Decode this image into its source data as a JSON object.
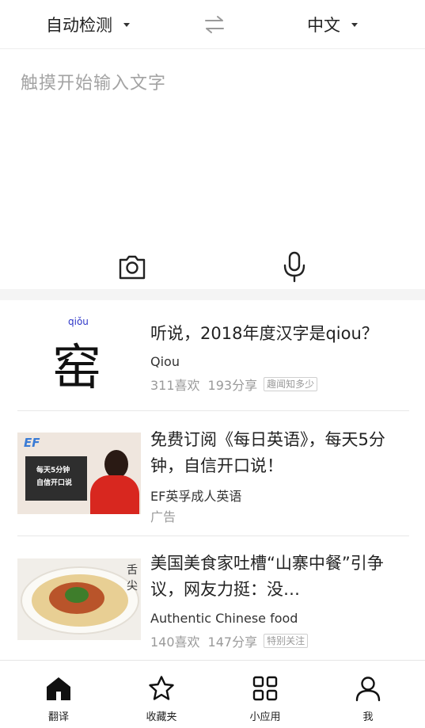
{
  "header": {
    "source_lang": "自动检测",
    "target_lang": "中文",
    "swap_icon": "swap-arrows-icon"
  },
  "input": {
    "placeholder": "触摸开始输入文字",
    "camera_icon": "camera-icon",
    "mic_icon": "microphone-icon"
  },
  "feed": {
    "items": [
      {
        "title": "听说，2018年度汉字是qiou？",
        "source": "Qiou",
        "likes": "311喜欢",
        "shares": "193分享",
        "tag": "趣闻知多少",
        "thumb_pinyin": "qiǒu",
        "thumb_char": "窑"
      },
      {
        "title": "免费订阅《每日英语》，每天5分钟，自信开口说！",
        "source": "EF英孚成人英语",
        "label": "广告",
        "thumb_logo": "EF",
        "thumb_line1": "每天5分钟",
        "thumb_line2": "自信开口说"
      },
      {
        "title": "美国美食家吐槽“山寨中餐”引争议，网友力挺：没…",
        "source": "Authentic Chinese food",
        "likes": "140喜欢",
        "shares": "147分享",
        "tag": "特别关注",
        "thumb_seal": "舌尖"
      }
    ]
  },
  "nav": {
    "items": [
      {
        "label": "翻译",
        "icon": "home-icon"
      },
      {
        "label": "收藏夹",
        "icon": "star-icon"
      },
      {
        "label": "小应用",
        "icon": "grid-icon"
      },
      {
        "label": "我",
        "icon": "person-icon"
      }
    ]
  },
  "colors": {
    "placeholder": "#a3a3a3",
    "divider_band": "#f4f4f4",
    "pinyin": "#2d36c8",
    "meta": "#9a9a9a"
  }
}
